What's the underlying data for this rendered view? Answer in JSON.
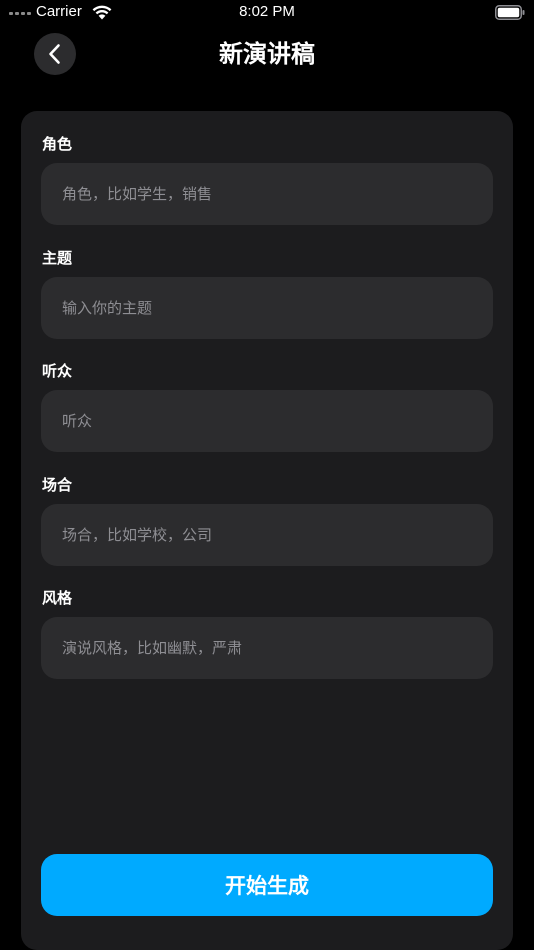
{
  "status_bar": {
    "carrier": "Carrier",
    "time": "8:02 PM"
  },
  "header": {
    "title": "新演讲稿",
    "back_icon": "chevron-left-icon"
  },
  "form": {
    "fields": [
      {
        "label": "角色",
        "placeholder": "角色，比如学生，销售",
        "value": ""
      },
      {
        "label": "主题",
        "placeholder": "输入你的主题",
        "value": ""
      },
      {
        "label": "听众",
        "placeholder": "听众",
        "value": ""
      },
      {
        "label": "场合",
        "placeholder": "场合，比如学校，公司",
        "value": ""
      },
      {
        "label": "风格",
        "placeholder": "演说风格，比如幽默，严肃",
        "value": ""
      }
    ],
    "submit_label": "开始生成"
  },
  "colors": {
    "background": "#000000",
    "card": "#1c1c1e",
    "input": "#2c2c2e",
    "accent": "#00aaff",
    "placeholder": "#8e8e93"
  }
}
